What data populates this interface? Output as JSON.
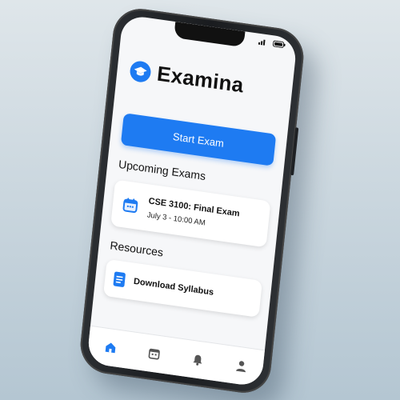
{
  "app": {
    "title": "Examina"
  },
  "main": {
    "start_button_label": "Start Exam",
    "upcoming": {
      "heading": "Upcoming Exams",
      "items": [
        {
          "title": "CSE 3100: Final Exam",
          "time": "July 3 - 10:00 AM",
          "icon": "calendar-icon"
        }
      ]
    },
    "resources": {
      "heading": "Resources",
      "items": [
        {
          "label": "Download Syllabus",
          "icon": "document-icon"
        }
      ]
    }
  },
  "tabbar": {
    "tabs": [
      {
        "icon": "home-icon",
        "active": true
      },
      {
        "icon": "calendar-icon",
        "active": false
      },
      {
        "icon": "bell-icon",
        "active": false
      },
      {
        "icon": "profile-icon",
        "active": false
      }
    ]
  },
  "colors": {
    "accent": "#1e7bf2",
    "background": "#f6f7f9",
    "text": "#111111",
    "inactive_icon": "#555555"
  }
}
